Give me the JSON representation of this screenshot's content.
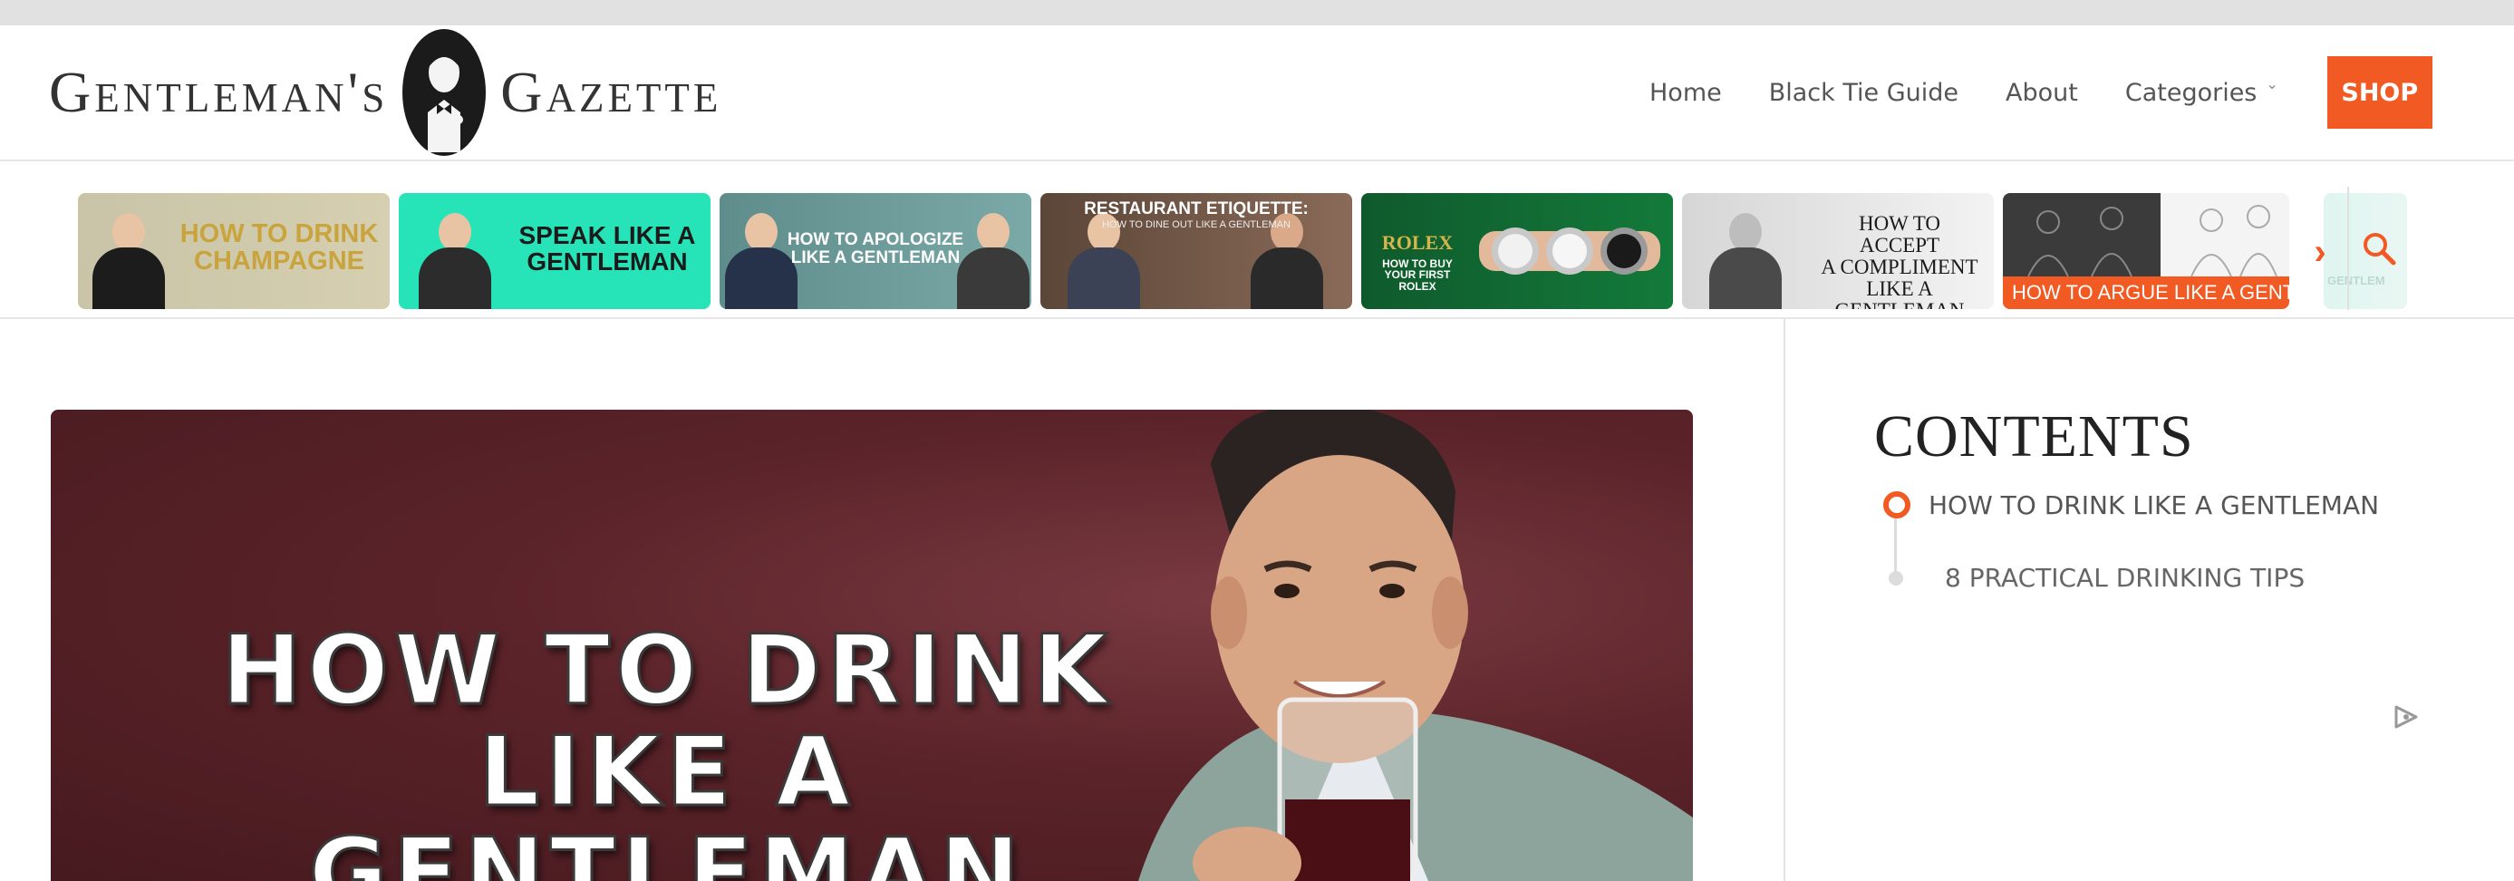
{
  "header": {
    "logo": {
      "left_word": "Gentleman's",
      "right_word": "Gazette"
    },
    "nav": {
      "home": "Home",
      "black_tie": "Black Tie Guide",
      "about": "About",
      "categories": "Categories",
      "shop": "SHOP"
    }
  },
  "strip": {
    "thumbs": [
      {
        "text": "HOW TO DRINK\nCHAMPAGNE"
      },
      {
        "text": "SPEAK LIKE A\nGENTLEMAN"
      },
      {
        "text": "HOW TO APOLOGIZE\nLIKE A GENTLEMAN"
      },
      {
        "text": "RESTAURANT ETIQUETTE:",
        "sub": "HOW TO DINE OUT LIKE A GENTLEMAN"
      },
      {
        "brand": "ROLEX",
        "text": "HOW TO BUY\nYOUR FIRST\nROLEX"
      },
      {
        "text": "HOW TO ACCEPT\nA COMPLIMENT\nLIKE A GENTLEMAN"
      },
      {
        "text": "HOW TO ARGUE LIKE A GENTLEMAN"
      }
    ],
    "partial_thumb": {
      "text": "GENTLEM"
    }
  },
  "hero": {
    "title_line1": "HOW TO DRINK",
    "title_line2": "LIKE A GENTLEMAN"
  },
  "contents": {
    "title": "CONTENTS",
    "items": [
      {
        "label": "HOW TO DRINK LIKE A GENTLEMAN",
        "active": true
      },
      {
        "label": "8 PRACTICAL DRINKING TIPS",
        "active": false
      }
    ]
  },
  "colors": {
    "accent": "#f15a22",
    "hero_bg": "#5a2329",
    "strip_teal": "#27e3b8"
  },
  "icons": {
    "next": "chevron-right-icon",
    "search": "search-icon",
    "ad": "ad-choices-icon"
  }
}
